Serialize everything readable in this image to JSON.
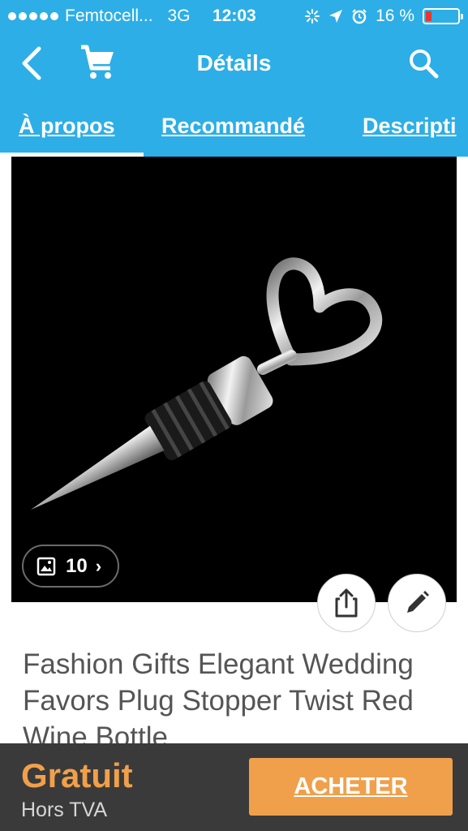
{
  "status_bar": {
    "carrier": "Femtocell...",
    "network": "3G",
    "time": "12:03",
    "battery": "16 %",
    "battery_level": 0.16,
    "icons": [
      "signal-dots-icon",
      "activity-icon",
      "location-arrow-icon",
      "alarm-icon",
      "battery-icon"
    ]
  },
  "nav": {
    "title": "Détails",
    "icons": [
      "back-icon",
      "cart-icon",
      "search-icon"
    ]
  },
  "tabs": [
    {
      "label": "À propos",
      "active": true
    },
    {
      "label": "Recommandé",
      "active": false
    },
    {
      "label": "Descripti",
      "active": false
    }
  ],
  "product": {
    "image_count": "10",
    "title": "Fashion Gifts Elegant Wedding Favors Plug Stopper Twist Red Wine Bottle"
  },
  "actions": {
    "icons": [
      "share-icon",
      "edit-icon"
    ]
  },
  "footer": {
    "price": "Gratuit",
    "tax_note": "Hors TVA",
    "buy_label": "ACHETER"
  },
  "colors": {
    "header": "#2daee6",
    "accent": "#f0a04b",
    "bottom_bar": "#3a3a3a",
    "battery_low": "#e8352d"
  }
}
